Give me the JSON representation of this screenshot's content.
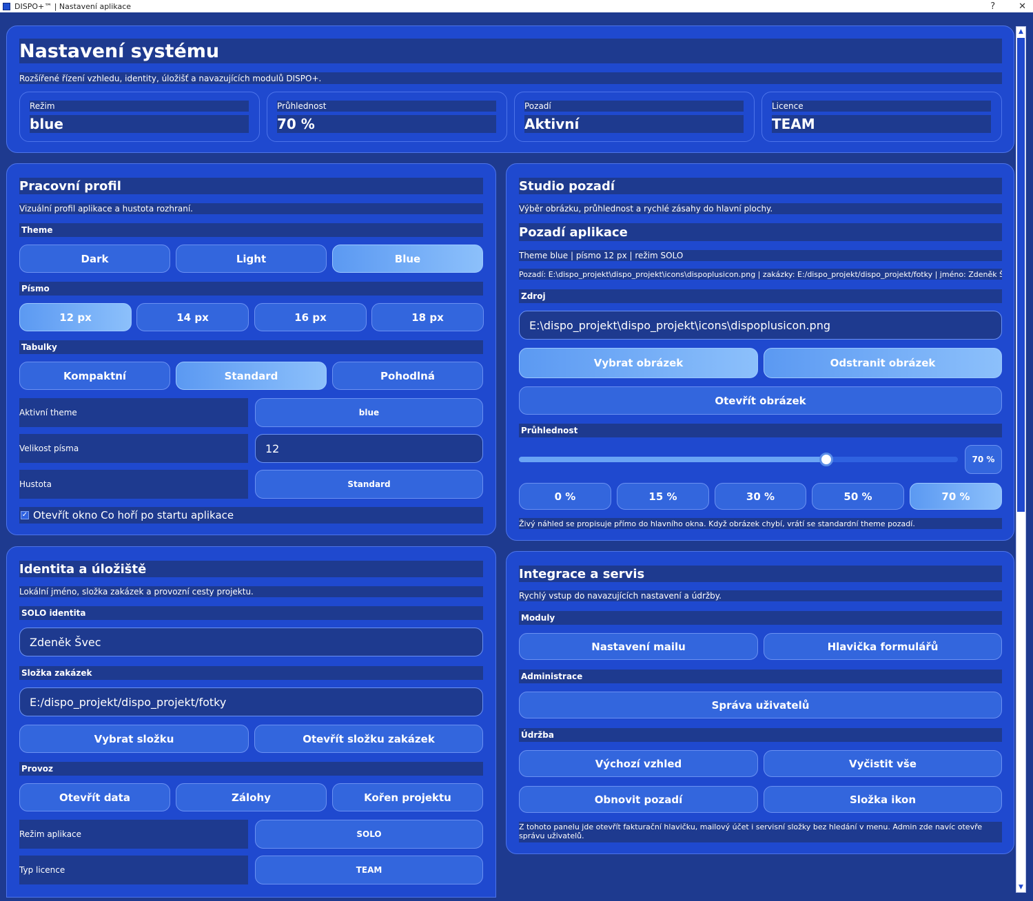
{
  "window": {
    "title": "DISPO+™ | Nastavení aplikace",
    "help": "?",
    "close": "✕"
  },
  "header": {
    "title": "Nastavení systému",
    "subtitle": "Rozšířené řízení vzhledu, identity, úložišť a navazujících modulů DISPO+.",
    "stats": [
      {
        "label": "Režim",
        "value": "blue"
      },
      {
        "label": "Průhlednost",
        "value": "70 %"
      },
      {
        "label": "Pozadí",
        "value": "Aktivní"
      },
      {
        "label": "Licence",
        "value": "TEAM"
      }
    ]
  },
  "profile": {
    "title": "Pracovní profil",
    "subtitle": "Vizuální profil aplikace a hustota rozhraní.",
    "theme_label": "Theme",
    "themes": [
      "Dark",
      "Light",
      "Blue"
    ],
    "font_label": "Písmo",
    "fonts": [
      "12 px",
      "14 px",
      "16 px",
      "18 px"
    ],
    "tables_label": "Tabulky",
    "tables": [
      "Kompaktní",
      "Standard",
      "Pohodlná"
    ],
    "active_theme_label": "Aktivní theme",
    "active_theme_value": "blue",
    "font_size_label": "Velikost písma",
    "font_size_value": "12",
    "density_label": "Hustota",
    "density_value": "Standard",
    "startup_check": "Otevřít okno Co hoří po startu aplikace"
  },
  "identity": {
    "title": "Identita a úložiště",
    "subtitle": "Lokální jméno, složka zakázek a provozní cesty projektu.",
    "solo_label": "SOLO identita",
    "solo_value": "Zdeněk Švec",
    "folder_label": "Složka zakázek",
    "folder_value": "E:/dispo_projekt/dispo_projekt/fotky",
    "pick_folder": "Vybrat složku",
    "open_folder": "Otevřít složku zakázek",
    "ops_label": "Provoz",
    "ops": [
      "Otevřít data",
      "Zálohy",
      "Kořen projektu"
    ],
    "mode_label": "Režim aplikace",
    "mode_value": "SOLO",
    "license_label": "Typ licence",
    "license_value": "TEAM"
  },
  "studio": {
    "title": "Studio pozadí",
    "subtitle": "Výběr obrázku, průhlednost a rychlé zásahy do hlavní plochy.",
    "bg_title": "Pozadí aplikace",
    "bg_info": "Theme blue | písmo 12 px | režim SOLO",
    "bg_path_info": "Pozadí: E:\\dispo_projekt\\dispo_projekt\\icons\\dispoplusicon.png | zakázky: E:/dispo_projekt/dispo_projekt/fotky | jméno: Zdeněk Švec",
    "source_label": "Zdroj",
    "source_value": "E:\\dispo_projekt\\dispo_projekt\\icons\\dispoplusicon.png",
    "pick_image": "Vybrat obrázek",
    "remove_image": "Odstranit obrázek",
    "open_image": "Otevřít obrázek",
    "opacity_label": "Průhlednost",
    "opacity_value": 0.7,
    "opacity_readout": "70 %",
    "presets": [
      "0 %",
      "15 %",
      "30 %",
      "50 %",
      "70 %"
    ],
    "note": "Živý náhled se propisuje přímo do hlavního okna. Když obrázek chybí, vrátí se standardní theme pozadí."
  },
  "integration": {
    "title": "Integrace a servis",
    "subtitle": "Rychlý vstup do navazujících nastavení a údržby.",
    "modules_label": "Moduly",
    "mail": "Nastavení mailu",
    "header_forms": "Hlavička formulářů",
    "admin_label": "Administrace",
    "users": "Správa uživatelů",
    "maint_label": "Údržba",
    "default_look": "Výchozí vzhled",
    "clear_all": "Vyčistit vše",
    "restore_bg": "Obnovit pozadí",
    "icon_folder": "Složka ikon",
    "note": "Z tohoto panelu jde otevřít fakturační hlavičku, mailový účet i servisní složky bez hledání v menu. Admin zde navíc otevře správu uživatelů."
  }
}
